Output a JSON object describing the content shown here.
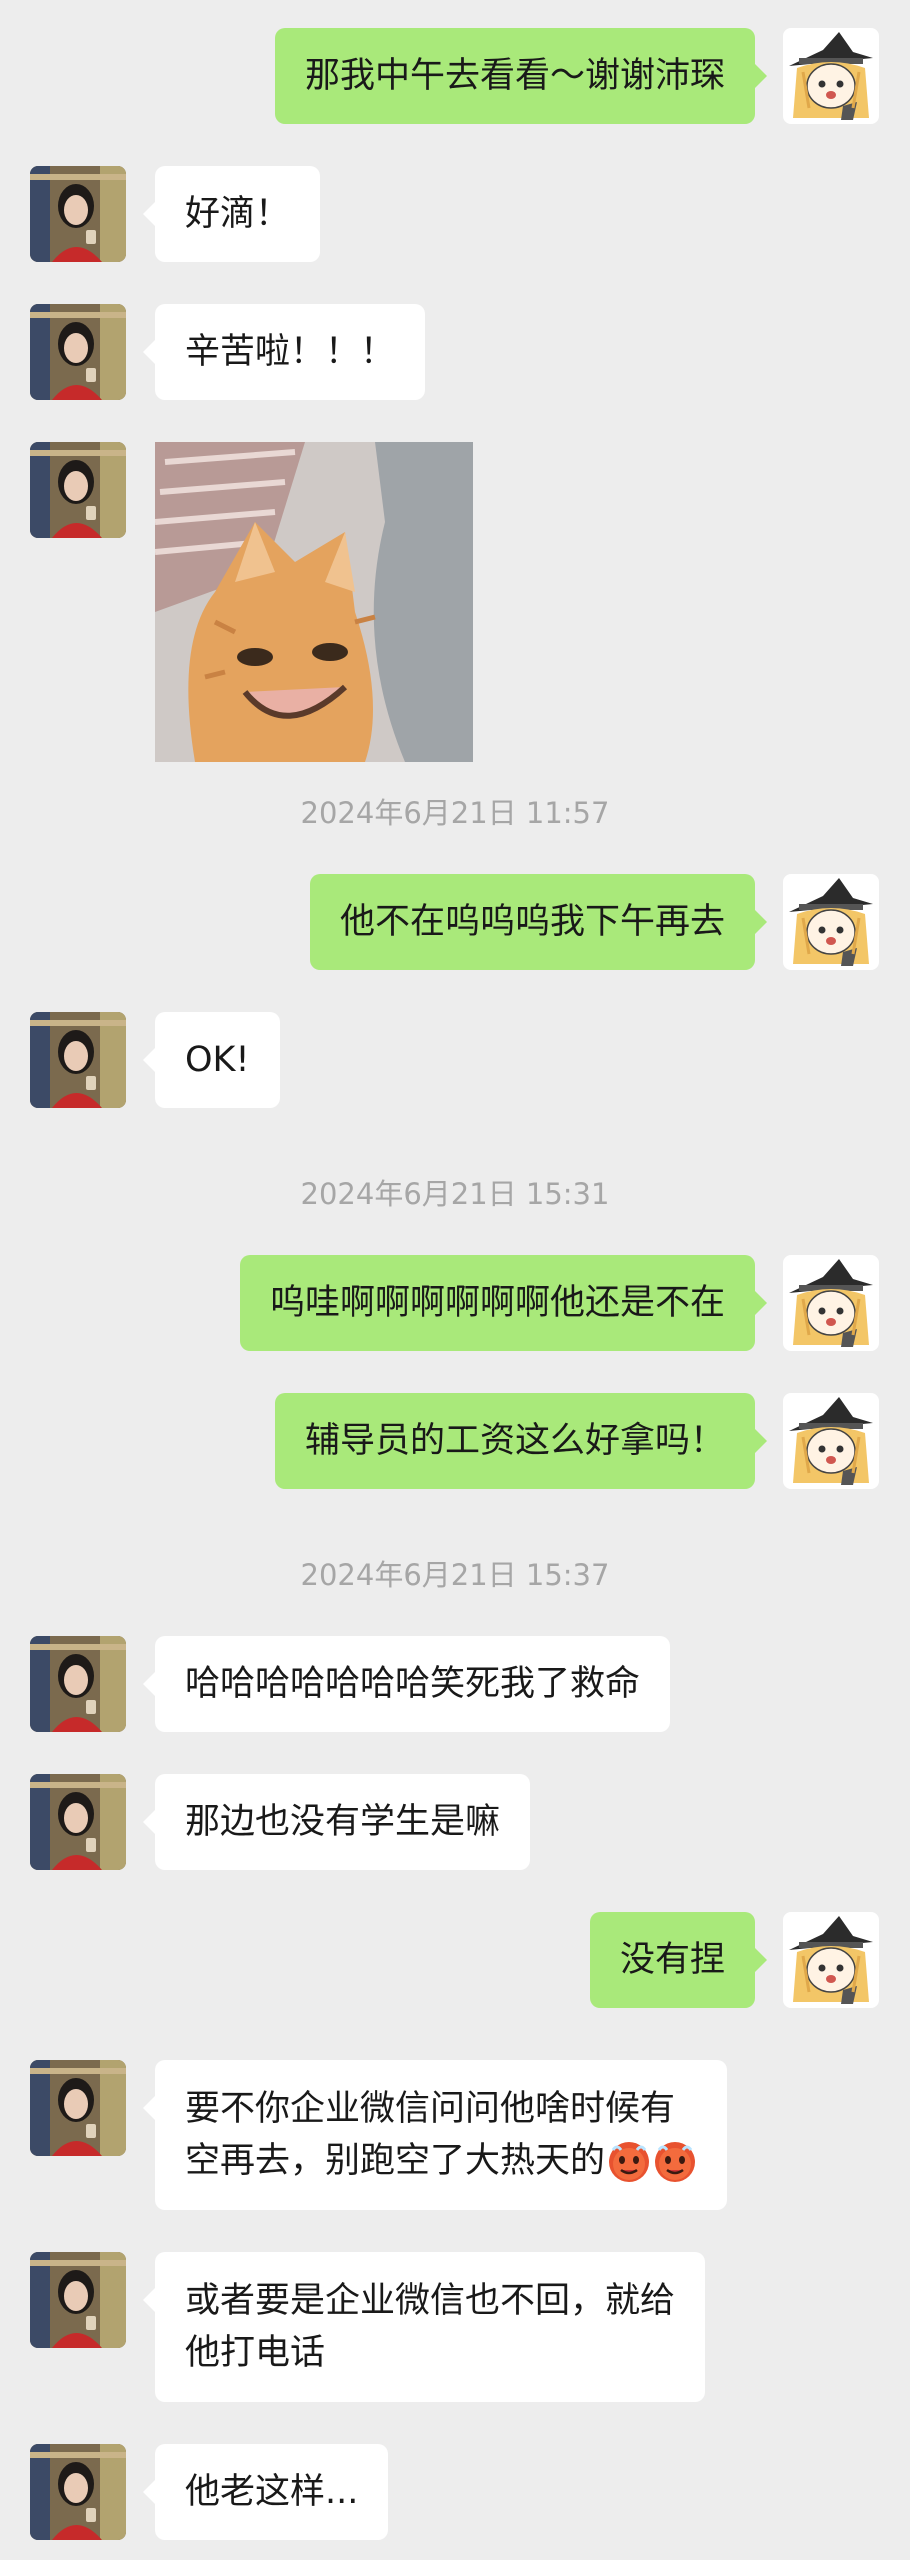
{
  "messages": [
    {
      "id": "m1",
      "side": "out",
      "text": "那我中午去看看～谢谢沛琛"
    },
    {
      "id": "m2",
      "side": "in",
      "text": "好滴！"
    },
    {
      "id": "m3",
      "side": "in",
      "text": "辛苦啦！！！"
    },
    {
      "id": "m4",
      "side": "in",
      "type": "image",
      "image": "smiling-cat-sticker"
    },
    {
      "id": "t1",
      "type": "time",
      "text": "2024年6月21日 11:57"
    },
    {
      "id": "m5",
      "side": "out",
      "text": "他不在呜呜呜我下午再去"
    },
    {
      "id": "m6",
      "side": "in",
      "text": "OK!"
    },
    {
      "id": "t2",
      "type": "time",
      "text": "2024年6月21日 15:31"
    },
    {
      "id": "m7",
      "side": "out",
      "text": "呜哇啊啊啊啊啊啊他还是不在"
    },
    {
      "id": "m8",
      "side": "out",
      "text": "辅导员的工资这么好拿吗！"
    },
    {
      "id": "t3",
      "type": "time",
      "text": "2024年6月21日 15:37"
    },
    {
      "id": "m9",
      "side": "in",
      "text": "哈哈哈哈哈哈哈笑死我了救命"
    },
    {
      "id": "m10",
      "side": "in",
      "text": "那边也没有学生是嘛"
    },
    {
      "id": "m11",
      "side": "out",
      "text": "没有捏"
    },
    {
      "id": "m12",
      "side": "in",
      "lines": [
        "要不你企业微信问问他啥时候有",
        "空再去，别跑空了大热天的"
      ],
      "emoji": [
        "hot-face-emoji",
        "hot-face-emoji"
      ]
    },
    {
      "id": "m13",
      "side": "in",
      "lines": [
        "或者要是企业微信也不回，就给",
        "他打电话"
      ]
    },
    {
      "id": "m14",
      "side": "in",
      "text": "他老这样..."
    }
  ],
  "avatars": {
    "self": "anime-girl-witch-hat-avatar",
    "contact": "girl-photo-avatar"
  },
  "colors": {
    "background": "#ededed",
    "outgoing_bubble": "#a9e97a",
    "incoming_bubble": "#ffffff",
    "timestamp": "#a6a6a6"
  }
}
